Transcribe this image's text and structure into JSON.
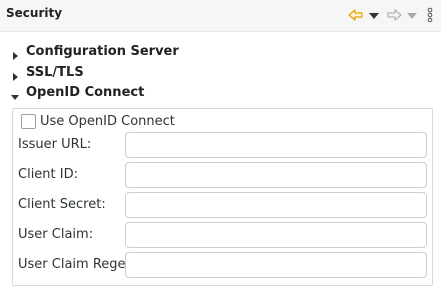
{
  "header": {
    "title": "Security",
    "toolbar": {
      "back_icon": "back-arrow-icon",
      "back_menu_icon": "dropdown-arrow-icon",
      "forward_icon": "forward-arrow-icon",
      "forward_menu_icon": "dropdown-arrow-icon",
      "view_menu_icon": "vertical-ellipsis-icon",
      "back_color": "#e8a400"
    }
  },
  "sections": [
    {
      "label": "Configuration Server",
      "expanded": false
    },
    {
      "label": "SSL/TLS",
      "expanded": false
    },
    {
      "label": "OpenID Connect",
      "expanded": true
    }
  ],
  "openid": {
    "use_checkbox_label": "Use OpenID Connect",
    "use_checked": false,
    "fields": [
      {
        "label": "Issuer URL:",
        "value": ""
      },
      {
        "label": "Client ID:",
        "value": ""
      },
      {
        "label": "Client Secret:",
        "value": ""
      },
      {
        "label": "User Claim:",
        "value": ""
      },
      {
        "label": "User Claim Regex:",
        "value": ""
      }
    ]
  }
}
